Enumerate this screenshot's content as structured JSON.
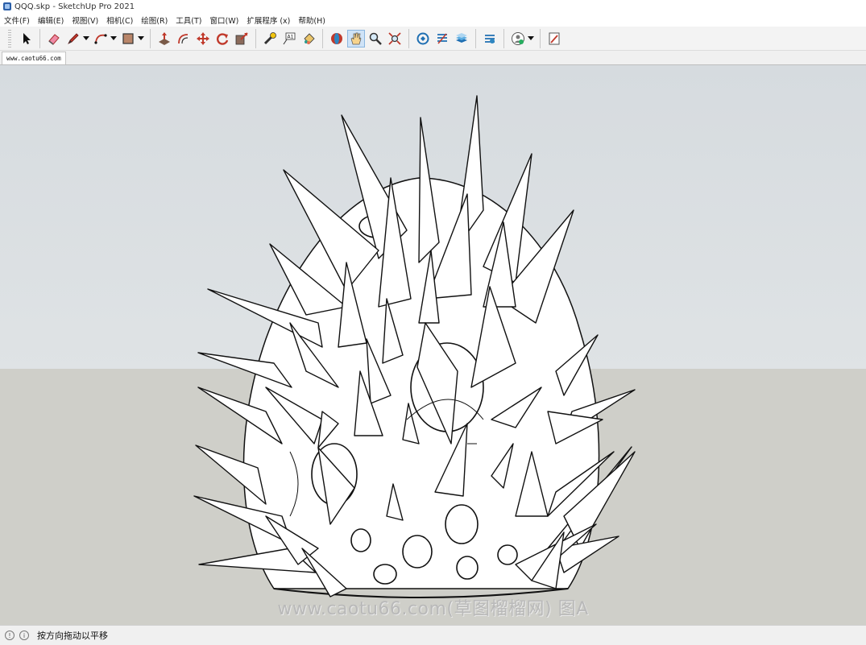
{
  "window": {
    "title": "QQQ.skp - SketchUp Pro 2021"
  },
  "menu": [
    "文件(F)",
    "编辑(E)",
    "视图(V)",
    "相机(C)",
    "绘图(R)",
    "工具(T)",
    "窗口(W)",
    "扩展程序 (x)",
    "帮助(H)"
  ],
  "toolbar": {
    "tools": [
      {
        "name": "select-tool",
        "icon": "arrow-cursor-icon"
      },
      {
        "name": "eraser-tool",
        "icon": "eraser-icon"
      },
      {
        "name": "line-tool",
        "icon": "pencil-icon",
        "dropdown": true
      },
      {
        "name": "arc-tool",
        "icon": "arc-icon",
        "dropdown": true
      },
      {
        "name": "rectangle-tool",
        "icon": "rectangle-icon",
        "dropdown": true
      },
      {
        "name": "push-pull-tool",
        "icon": "push-pull-icon"
      },
      {
        "name": "offset-tool",
        "icon": "offset-icon"
      },
      {
        "name": "move-tool",
        "icon": "move-icon"
      },
      {
        "name": "rotate-tool",
        "icon": "rotate-icon"
      },
      {
        "name": "scale-tool",
        "icon": "scale-icon"
      },
      {
        "name": "tape-measure-tool",
        "icon": "tape-measure-icon"
      },
      {
        "name": "text-tool",
        "icon": "text-icon"
      },
      {
        "name": "paint-bucket-tool",
        "icon": "paint-bucket-icon"
      },
      {
        "name": "orbit-tool",
        "icon": "orbit-icon"
      },
      {
        "name": "pan-tool",
        "icon": "hand-icon",
        "active": true
      },
      {
        "name": "zoom-tool",
        "icon": "magnifier-icon"
      },
      {
        "name": "zoom-extents-tool",
        "icon": "zoom-extents-icon"
      },
      {
        "name": "3d-warehouse",
        "icon": "warehouse-icon"
      },
      {
        "name": "extension-warehouse",
        "icon": "extension-warehouse-icon"
      },
      {
        "name": "layout-send",
        "icon": "layout-icon"
      },
      {
        "name": "extension-manager",
        "icon": "extension-manager-icon"
      },
      {
        "name": "account",
        "icon": "account-icon",
        "dropdown": true
      },
      {
        "name": "send-to-layout",
        "icon": "send-to-layout-icon"
      }
    ]
  },
  "scene_tab": {
    "label": "www.caotu66.com"
  },
  "watermark": "www.caotu66.com(草图榴榴网) 图A",
  "status": {
    "text": "按方向拖动以平移",
    "icon1": "!",
    "icon2": "i"
  },
  "colors": {
    "sky": "#dfe3e5",
    "ground": "#cfcfc9",
    "model": "#ffffff",
    "edge": "#111111"
  }
}
